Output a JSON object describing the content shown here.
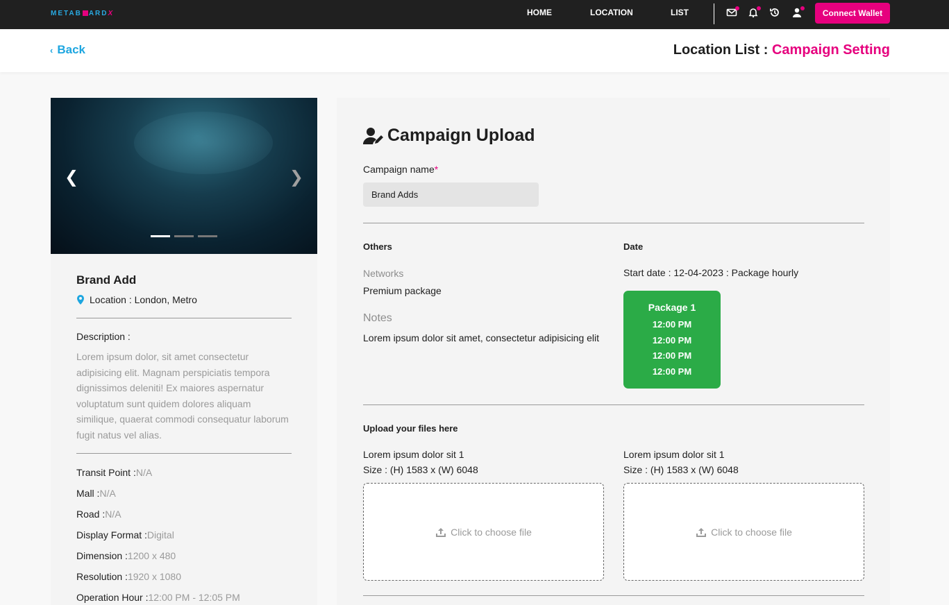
{
  "brand": {
    "logo_text": "METABOARDX",
    "accent": "#e6007e",
    "secondary": "#1ea6e0"
  },
  "nav": {
    "links": [
      "HOME",
      "LOCATION",
      "LIST"
    ],
    "icons": [
      "mail-icon",
      "bell-icon",
      "history-icon",
      "user-icon"
    ],
    "connect_label": "Connect Wallet"
  },
  "subheader": {
    "back_label": "Back",
    "crumb_main": "Location List",
    "crumb_sep": " : ",
    "crumb_accent": "Campaign Setting"
  },
  "location_card": {
    "slider_count": 3,
    "slider_active": 1,
    "title": "Brand Add",
    "location": "Location : London, Metro",
    "description_label": "Description :",
    "description": "Lorem ipsum dolor, sit amet consectetur adipisicing elit. Magnam perspiciatis tempora dignissimos deleniti! Ex maiores aspernatur voluptatum sunt quidem dolores aliquam similique, quaerat commodi consequatur laborum fugit natus vel alias.",
    "specs": [
      {
        "label": "Transit Point :",
        "value": "N/A"
      },
      {
        "label": "Mall :",
        "value": "N/A"
      },
      {
        "label": "Road :",
        "value": "N/A"
      },
      {
        "label": "Display Format :",
        "value": "Digital"
      },
      {
        "label": "Dimension :",
        "value": "1200 x 480"
      },
      {
        "label": "Resolution :",
        "value": "1920 x 1080"
      },
      {
        "label": "Operation Hour :",
        "value": "12:00 PM - 12:05 PM"
      }
    ]
  },
  "campaign": {
    "title": "Campaign Upload",
    "name_label": "Campaign name",
    "name_required": "*",
    "name_value": "Brand Adds",
    "others_head": "Others",
    "networks_label": "Networks",
    "networks_value": "Premium package",
    "notes_label": "Notes",
    "notes_value": "Lorem ipsum dolor sit amet, consectetur adipisicing elit",
    "date_head": "Date",
    "date_line": "Start date : 12-04-2023 : Package hourly",
    "package": {
      "name": "Package 1",
      "times": [
        "12:00 PM",
        "12:00 PM",
        "12:00 PM",
        "12:00 PM"
      ],
      "color": "#2bab47"
    },
    "upload_head": "Upload your files here",
    "uploads": [
      {
        "name": "Lorem ipsum dolor sit 1",
        "size": "Size : (H) 1583 x (W) 6048",
        "cta": "Click to choose file"
      },
      {
        "name": "Lorem ipsum dolor sit 1",
        "size": "Size : (H) 1583 x (W) 6048",
        "cta": "Click to choose file"
      }
    ]
  }
}
